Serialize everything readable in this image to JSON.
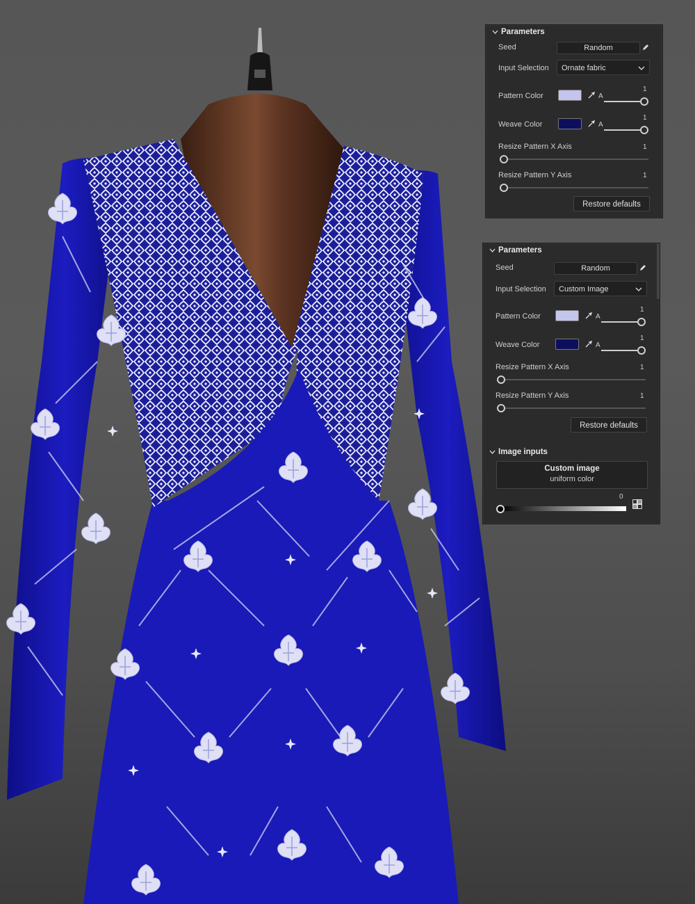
{
  "panel_top": {
    "header": "Parameters",
    "seed": {
      "label": "Seed",
      "value": "Random"
    },
    "input_selection": {
      "label": "Input Selection",
      "value": "Ornate fabric"
    },
    "pattern_color": {
      "label": "Pattern Color",
      "color": "#c4c5ec",
      "alpha_label": "A",
      "alpha_value": "1"
    },
    "weave_color": {
      "label": "Weave Color",
      "color": "#0d0f5c",
      "alpha_label": "A",
      "alpha_value": "1"
    },
    "resize_x": {
      "label": "Resize Pattern X Axis",
      "value": "1"
    },
    "resize_y": {
      "label": "Resize Pattern Y Axis",
      "value": "1"
    },
    "restore": "Restore defaults"
  },
  "panel_bottom": {
    "header": "Parameters",
    "seed": {
      "label": "Seed",
      "value": "Random"
    },
    "input_selection": {
      "label": "Input Selection",
      "value": "Custom Image"
    },
    "pattern_color": {
      "label": "Pattern Color",
      "color": "#c4c5ec",
      "alpha_label": "A",
      "alpha_value": "1"
    },
    "weave_color": {
      "label": "Weave Color",
      "color": "#0d0f5c",
      "alpha_label": "A",
      "alpha_value": "1"
    },
    "resize_x": {
      "label": "Resize Pattern X Axis",
      "value": "1"
    },
    "resize_y": {
      "label": "Resize Pattern Y Axis",
      "value": "1"
    },
    "restore": "Restore defaults",
    "image_inputs": {
      "header": "Image inputs",
      "card_title": "Custom image",
      "card_subtitle": "uniform color",
      "slider_value": "0",
      "slider_fraction": 0
    }
  },
  "scene": {
    "dress_color": "#1a1ab8",
    "bodice_color": "#f2f2fb",
    "mannequin_color": "#5a3220"
  },
  "icons": [
    "chevron-down-icon",
    "pencil-icon",
    "eyedropper-icon",
    "dropdown-arrow-icon",
    "random-icon"
  ]
}
